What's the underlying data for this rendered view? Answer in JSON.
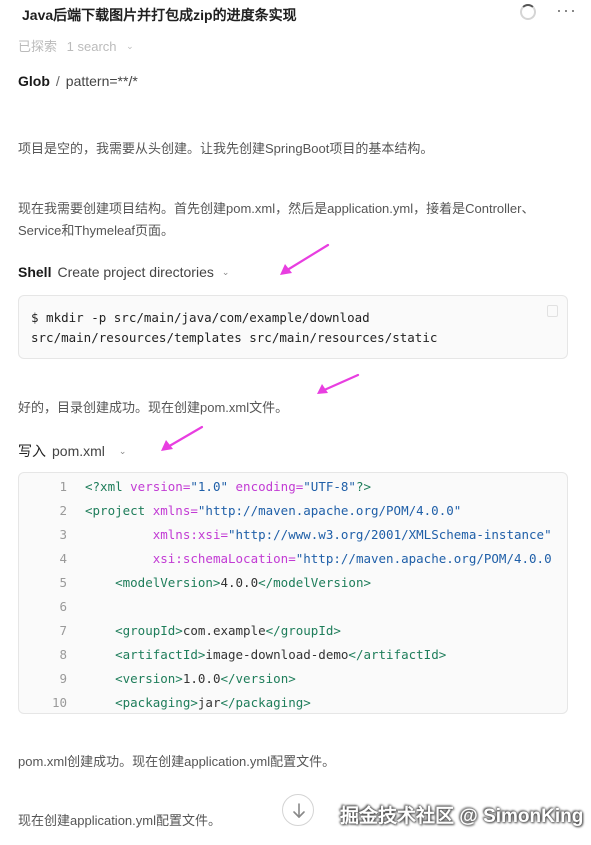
{
  "header": {
    "title": "Java后端下载图片并打包成zip的进度条实现",
    "more_label": "···"
  },
  "explored": {
    "label": "已探索",
    "count": "1 search",
    "chevron": "⌄"
  },
  "glob": {
    "tool": "Glob",
    "separator": "/",
    "pattern": "pattern=**/*"
  },
  "messages": {
    "m1": "项目是空的，我需要从头创建。让我先创建SpringBoot项目的基本结构。",
    "m2": "现在我需要创建项目结构。首先创建pom.xml，然后是application.yml，接着是Controller、Service和Thymeleaf页面。",
    "m3": "好的，目录创建成功。现在创建pom.xml文件。",
    "m4": "pom.xml创建成功。现在创建application.yml配置文件。",
    "m5": "现在创建application.yml配置文件。"
  },
  "shell": {
    "tool": "Shell",
    "description": "Create project directories",
    "chevron": "⌄",
    "command_line1": "$ mkdir -p src/main/java/com/example/download",
    "command_line2": "src/main/resources/templates src/main/resources/static"
  },
  "write": {
    "tool": "写入",
    "filename": "pom.xml",
    "chevron": "⌄",
    "lines": [
      {
        "n": "1",
        "p1": "<?xml ",
        "p2": "version=",
        "p3": "\"1.0\" ",
        "p4": "encoding=",
        "p5": "\"UTF-8\"",
        "p6": "?>"
      },
      {
        "n": "2",
        "p1": "<project ",
        "p2": "xmlns=",
        "p3": "\"http://maven.apache.org/POM/4.0.0\"",
        "p4": "",
        "p5": "",
        "p6": ""
      },
      {
        "n": "3",
        "p1": "         ",
        "p2": "xmlns:xsi=",
        "p3": "\"http://www.w3.org/2001/XMLSchema-instance\"",
        "p4": "",
        "p5": "",
        "p6": ""
      },
      {
        "n": "4",
        "p1": "         ",
        "p2": "xsi:schemaLocation=",
        "p3": "\"http://maven.apache.org/POM/4.0.0",
        "p4": "",
        "p5": "",
        "p6": ""
      },
      {
        "n": "5",
        "p1": "    <modelVersion>",
        "p2": "",
        "p3": "4.0.0",
        "p4": "</modelVersion>",
        "p5": "",
        "p6": ""
      },
      {
        "n": "6",
        "p1": "",
        "p2": "",
        "p3": "",
        "p4": "",
        "p5": "",
        "p6": ""
      },
      {
        "n": "7",
        "p1": "    <groupId>",
        "p2": "",
        "p3": "com.example",
        "p4": "</groupId>",
        "p5": "",
        "p6": ""
      },
      {
        "n": "8",
        "p1": "    <artifactId>",
        "p2": "",
        "p3": "image-download-demo",
        "p4": "</artifactId>",
        "p5": "",
        "p6": ""
      },
      {
        "n": "9",
        "p1": "    <version>",
        "p2": "",
        "p3": "1.0.0",
        "p4": "</version>",
        "p5": "",
        "p6": ""
      },
      {
        "n": "10",
        "p1": "    <packaging>",
        "p2": "",
        "p3": "jar",
        "p4": "</packaging>",
        "p5": "",
        "p6": ""
      }
    ]
  },
  "watermark": "掘金技术社区 @ SimonKing",
  "colors": {
    "annotation_arrow": "#e83ee0",
    "xml_tag": "#1e7d5a",
    "xml_attr": "#c23bd4",
    "xml_string": "#1f5fa8"
  }
}
